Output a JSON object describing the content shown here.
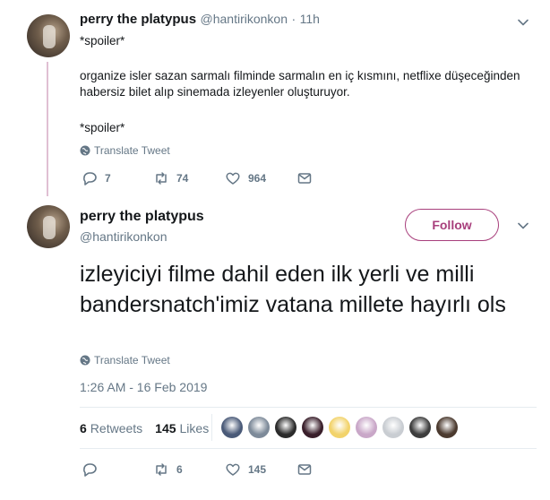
{
  "tweet1": {
    "author_name": "perry the platypus",
    "author_handle": "@hantirikonkon",
    "separator": "·",
    "time": "11h",
    "lines": [
      "*spoiler*",
      "organize isler sazan sarmalı filminde sarmalın en iç kısmını, netflixe düşeceğinden",
      "habersiz bilet alıp sinemada izleyenler oluşturuyor.",
      "*spoiler*"
    ],
    "translate_label": "Translate Tweet",
    "reply_count": "7",
    "retweet_count": "74",
    "like_count": "964"
  },
  "tweet2": {
    "author_name": "perry the platypus",
    "author_handle": "@hantirikonkon",
    "follow_label": "Follow",
    "text": "izleyiciyi filme dahil eden ilk yerli ve milli bandersnatch'imiz vatana millete hayırlı ols",
    "translate_label": "Translate Tweet",
    "timestamp": "1:26 AM - 16 Feb 2019",
    "retweets_count": "6",
    "retweets_label": "Retweets",
    "likes_count": "145",
    "likes_label": "Likes",
    "reply_count": "",
    "retweet_count": "6",
    "like_count": "145"
  },
  "colors": {
    "accent": "#a83f7c",
    "thread_line": "#e0bfd3",
    "muted": "#657786",
    "text": "#14171a",
    "likers": [
      "#4a5a78",
      "#7d8a99",
      "#2b2b2b",
      "#3a1f2b",
      "#f2d36b",
      "#c9a7c8",
      "#c9cdd2",
      "#3d3d3d",
      "#4b3a2f"
    ]
  }
}
